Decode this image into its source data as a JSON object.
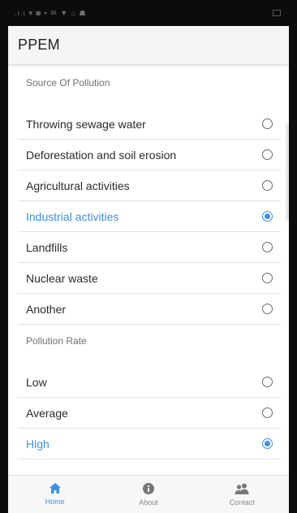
{
  "app": {
    "title": "PPEM",
    "accent_color": "#3d8fe6"
  },
  "status_bar": {
    "left_icons": ".ı.ı ▾ ◙ ▪ ✉ ▼ ⌂ ☗"
  },
  "source_section": {
    "label": "Source Of Pollution",
    "options": [
      {
        "label": "Throwing sewage water",
        "selected": false
      },
      {
        "label": "Deforestation and soil erosion",
        "selected": false
      },
      {
        "label": "Agricultural activities",
        "selected": false
      },
      {
        "label": "Industrial activities",
        "selected": true
      },
      {
        "label": "Landfills",
        "selected": false
      },
      {
        "label": "Nuclear waste",
        "selected": false
      },
      {
        "label": "Another",
        "selected": false
      }
    ]
  },
  "rate_section": {
    "label": "Pollution Rate",
    "options": [
      {
        "label": "Low",
        "selected": false
      },
      {
        "label": "Average",
        "selected": false
      },
      {
        "label": "High",
        "selected": true
      }
    ]
  },
  "bottom_nav": {
    "tabs": [
      {
        "label": "Home",
        "icon": "home-icon",
        "active": true
      },
      {
        "label": "About",
        "icon": "info-icon",
        "active": false
      },
      {
        "label": "Contact",
        "icon": "people-icon",
        "active": false
      }
    ]
  }
}
